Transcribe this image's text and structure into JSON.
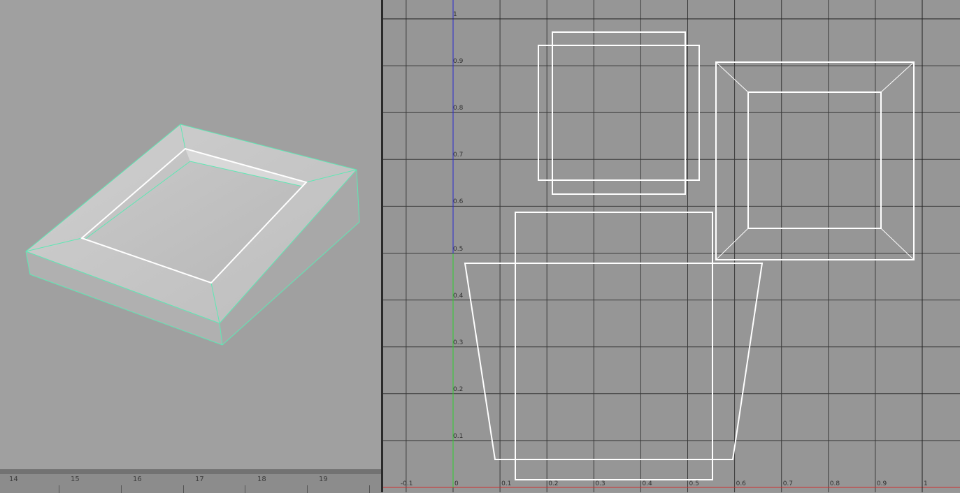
{
  "viewport": {
    "background": "#a0a0a0",
    "wire_color": "#5ee8b4",
    "edge_selected_color": "#ffffff"
  },
  "timeline": {
    "frames": [
      "14",
      "15",
      "16",
      "17",
      "18",
      "19"
    ]
  },
  "uv_editor": {
    "background": "#969696",
    "grid_color": "#3a3a3a",
    "u_axis_color": "#d03030",
    "v_axis_color_upper": "#2a2ad0",
    "v_axis_color_lower": "#2fd02f",
    "shell_color": "#ffffff",
    "u_labels": [
      "-0.1",
      "0",
      "0.1",
      "0.2",
      "0.3",
      "0.4",
      "0.5",
      "0.6",
      "0.7",
      "0.8",
      "0.9",
      "1"
    ],
    "v_labels": [
      "1",
      "0.9",
      "0.8",
      "0.7",
      "0.6",
      "0.5",
      "0.4",
      "0.3",
      "0.2",
      "0.1"
    ]
  }
}
